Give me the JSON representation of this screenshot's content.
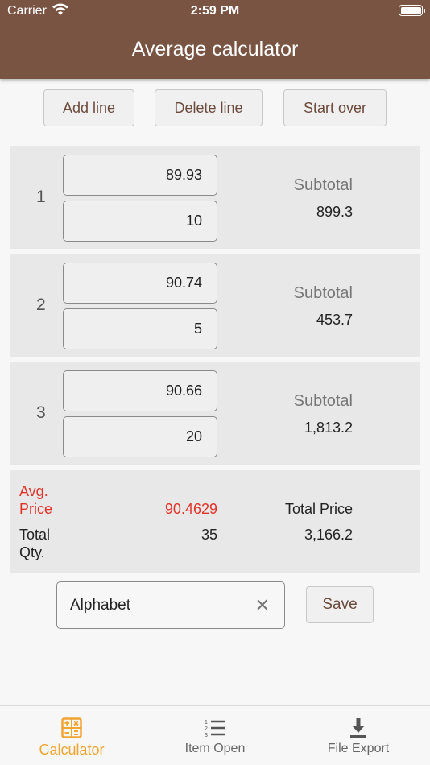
{
  "status_bar": {
    "carrier": "Carrier",
    "time": "2:59 PM"
  },
  "app_bar": {
    "title": "Average calculator"
  },
  "actions": {
    "add": "Add line",
    "delete": "Delete line",
    "start_over": "Start over"
  },
  "lines": [
    {
      "index": "1",
      "price": "89.93",
      "qty": "10",
      "subtotal_label": "Subtotal",
      "subtotal": "899.3"
    },
    {
      "index": "2",
      "price": "90.74",
      "qty": "5",
      "subtotal_label": "Subtotal",
      "subtotal": "453.7"
    },
    {
      "index": "3",
      "price": "90.66",
      "qty": "20",
      "subtotal_label": "Subtotal",
      "subtotal": "1,813.2"
    }
  ],
  "summary": {
    "avg_price_label": "Avg.\nPrice",
    "avg_price": "90.4629",
    "total_price_label": "Total Price",
    "total_qty_label": "Total\nQty.",
    "total_qty": "35",
    "total_price": "3,166.2"
  },
  "save_form": {
    "name_value": "Alphabet",
    "save_label": "Save"
  },
  "bottom_nav": [
    {
      "label": "Calculator",
      "icon": "calculator-icon",
      "active": true
    },
    {
      "label": "Item Open",
      "icon": "list-icon",
      "active": false
    },
    {
      "label": "File Export",
      "icon": "download-icon",
      "active": false
    }
  ],
  "colors": {
    "app_bar": "#7a5443",
    "accent": "#f0a431",
    "warning": "#e0342a",
    "button_text": "#6b4a3c"
  }
}
